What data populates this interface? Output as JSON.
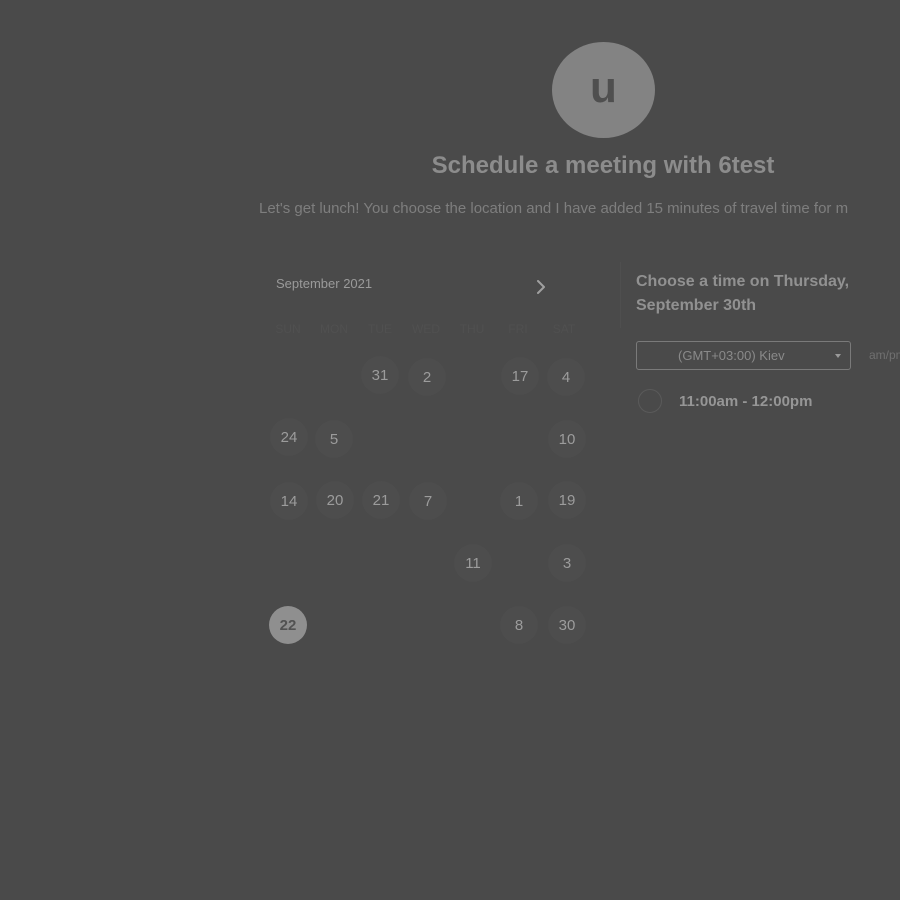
{
  "avatar": {
    "letter": "u"
  },
  "title": "Schedule a meeting with 6test",
  "subtitle": "Let's get lunch! You choose the location and I have added 15 minutes of travel time for m",
  "calendar": {
    "month_label": "September 2021",
    "next_icon": "chevron-right-icon",
    "weekdays": [
      "SUN",
      "MON",
      "TUE",
      "WED",
      "THU",
      "FRI",
      "SAT"
    ],
    "selected_day": "22",
    "days": [
      {
        "label": "31"
      },
      {
        "label": "2"
      },
      {
        "label": "17"
      },
      {
        "label": "4"
      },
      {
        "label": "24"
      },
      {
        "label": "5"
      },
      {
        "label": "10"
      },
      {
        "label": "14"
      },
      {
        "label": "20"
      },
      {
        "label": "21"
      },
      {
        "label": "7"
      },
      {
        "label": "1"
      },
      {
        "label": "19"
      },
      {
        "label": "11"
      },
      {
        "label": "3"
      },
      {
        "label": "22"
      },
      {
        "label": "8"
      },
      {
        "label": "30"
      }
    ]
  },
  "time_panel": {
    "title": "Choose a time on Thursday, September 30th",
    "timezone": "(GMT+03:00) Kiev",
    "format_toggle": "am/pm",
    "slots": [
      {
        "label": "11:00am - 12:00pm"
      }
    ]
  }
}
